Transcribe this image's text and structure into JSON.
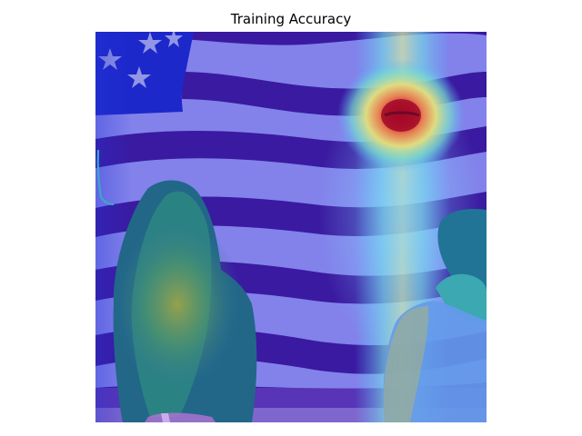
{
  "figure": {
    "title": "Training Accuracy"
  },
  "image": {
    "subject": "american-flag-with-two-people-attention-heatmap",
    "colormap": "jet"
  },
  "colors": {
    "flag_stripe_red_under_overlay": "#3a1393",
    "flag_stripe_white_under_overlay": "#8b86e6",
    "canton_blue": "#1922c8",
    "heatmap_peak": "#c8001e",
    "overlay_low": "#3c50ff"
  }
}
